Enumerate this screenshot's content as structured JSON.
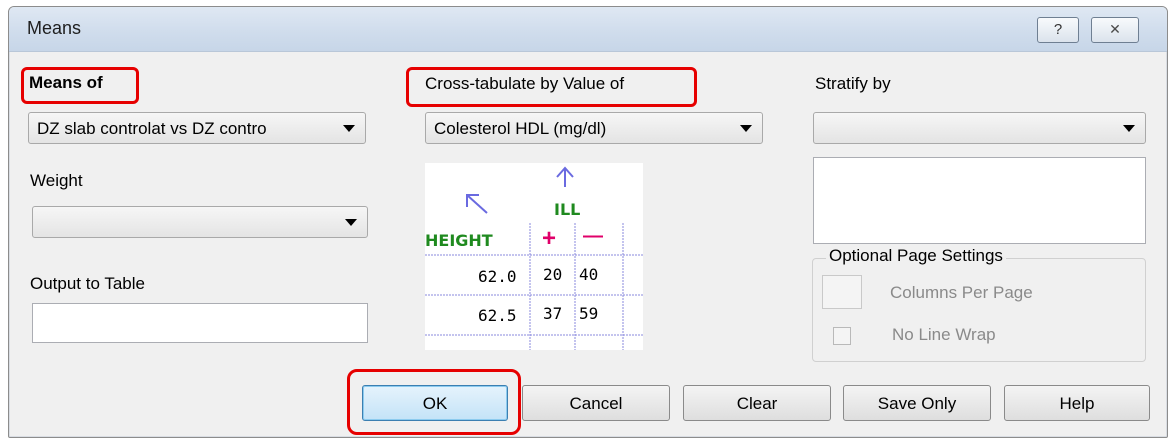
{
  "window": {
    "title": "Means",
    "help_icon": "?",
    "close_icon": "✕"
  },
  "means_of": {
    "label": "Means of",
    "value": "DZ slab controlat vs DZ contro"
  },
  "weight": {
    "label": "Weight",
    "value": ""
  },
  "output_to_table": {
    "label": "Output to Table",
    "value": ""
  },
  "cross_tab": {
    "label": "Cross-tabulate by Value of",
    "value": "Colesterol HDL (mg/dl)"
  },
  "illustration": {
    "ill_label": "ILL",
    "height_label": "HEIGHT",
    "plus": "+",
    "minus": "—",
    "rows": [
      {
        "height": "62.0",
        "plus": "20",
        "minus": "40"
      },
      {
        "height": "62.5",
        "plus": "37",
        "minus": "59"
      }
    ],
    "colors": {
      "green": "#1f8a1f",
      "magenta": "#e0006a",
      "blue": "#6a6ae0"
    }
  },
  "stratify": {
    "label": "Stratify by",
    "value": ""
  },
  "optional_page_settings": {
    "legend": "Optional Page Settings",
    "columns_per_page_label": "Columns Per Page",
    "no_line_wrap_label": "No Line Wrap"
  },
  "buttons": {
    "ok": "OK",
    "cancel": "Cancel",
    "clear": "Clear",
    "save_only": "Save Only",
    "help": "Help"
  },
  "colors": {
    "highlight": "#e60000",
    "default_button_border": "#3c7fb1"
  }
}
